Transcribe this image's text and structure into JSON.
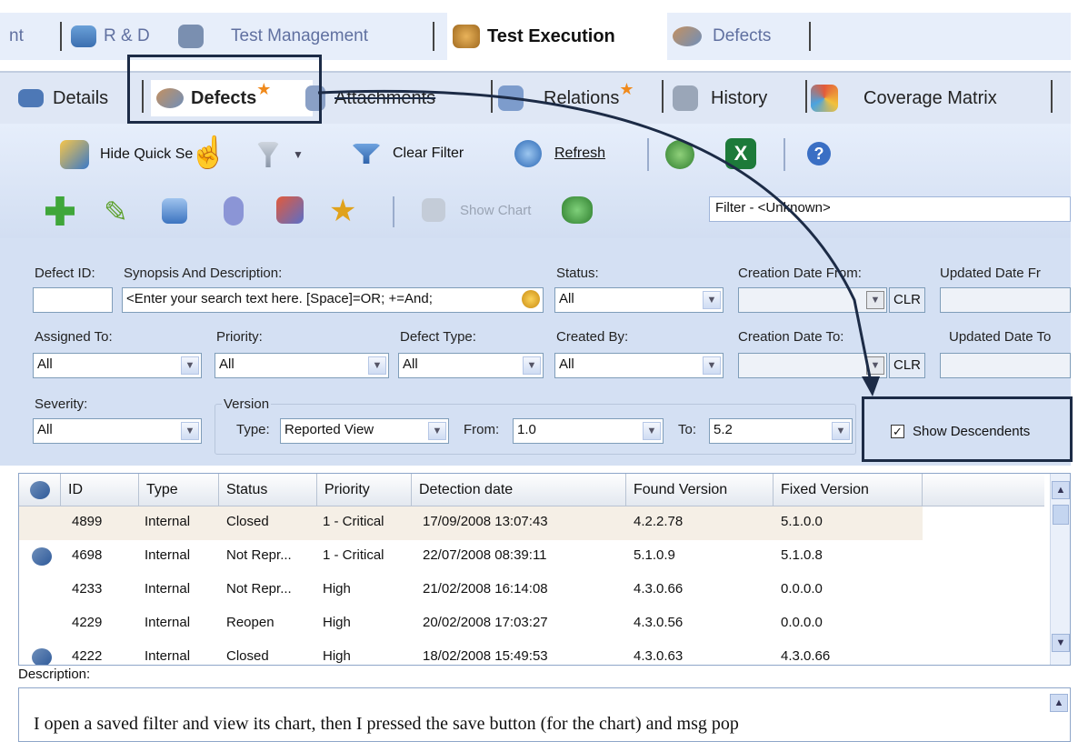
{
  "top_tabs": [
    {
      "label": "nt"
    },
    {
      "label": "R & D"
    },
    {
      "label": "Test Management"
    },
    {
      "label": "Test Execution"
    },
    {
      "label": "Defects"
    }
  ],
  "sub_tabs": [
    {
      "label": "Details"
    },
    {
      "label": "Defects"
    },
    {
      "label": "Attachments"
    },
    {
      "label": "Relations"
    },
    {
      "label": "History"
    },
    {
      "label": "Coverage Matrix"
    }
  ],
  "toolbar": {
    "hide_quick_search": "Hide Quick Se",
    "clear_filter": "Clear Filter",
    "refresh": "Refresh",
    "show_chart": "Show Chart",
    "filter_value": "Filter - <Unknown>"
  },
  "filters": {
    "defect_id_label": "Defect ID:",
    "synopsis_label": "Synopsis And Description:",
    "synopsis_placeholder": "<Enter your search text here. [Space]=OR; +=And;",
    "status_label": "Status:",
    "status_value": "All",
    "creation_from_label": "Creation Date From:",
    "updated_from_label": "Updated Date Fr",
    "assigned_label": "Assigned To:",
    "assigned_value": "All",
    "priority_label": "Priority:",
    "priority_value": "All",
    "defect_type_label": "Defect Type:",
    "defect_type_value": "All",
    "created_by_label": "Created By:",
    "created_by_value": "All",
    "creation_to_label": "Creation Date To:",
    "updated_to_label": "Updated Date To",
    "severity_label": "Severity:",
    "severity_value": "All",
    "version_label": "Version",
    "type_label": "Type:",
    "type_value": "Reported View",
    "from_label": "From:",
    "from_value": "1.0",
    "to_label": "To:",
    "to_value": "5.2",
    "clr": "CLR",
    "show_descendents": "Show Descendents"
  },
  "grid": {
    "headers": [
      "ID",
      "Type",
      "Status",
      "Priority",
      "Detection date",
      "Found Version",
      "Fixed Version"
    ],
    "rows": [
      {
        "id": "4899",
        "type": "Internal",
        "status": "Closed",
        "priority": "1 - Critical",
        "date": "17/09/2008 13:07:43",
        "found": "4.2.2.78",
        "fixed": "5.1.0.0"
      },
      {
        "id": "4698",
        "type": "Internal",
        "status": "Not Repr...",
        "priority": "1 - Critical",
        "date": "22/07/2008 08:39:11",
        "found": "5.1.0.9",
        "fixed": "5.1.0.8"
      },
      {
        "id": "4233",
        "type": "Internal",
        "status": "Not Repr...",
        "priority": "High",
        "date": "21/02/2008 16:14:08",
        "found": "4.3.0.66",
        "fixed": "0.0.0.0"
      },
      {
        "id": "4229",
        "type": "Internal",
        "status": "Reopen",
        "priority": "High",
        "date": "20/02/2008 17:03:27",
        "found": "4.3.0.56",
        "fixed": "0.0.0.0"
      },
      {
        "id": "4222",
        "type": "Internal",
        "status": "Closed",
        "priority": "High",
        "date": "18/02/2008 15:49:53",
        "found": "4.3.0.63",
        "fixed": "4.3.0.66"
      }
    ]
  },
  "description": {
    "label": "Description:",
    "text": "I open a saved filter and view its chart, then I pressed the save button (for the chart) and msg pop"
  }
}
